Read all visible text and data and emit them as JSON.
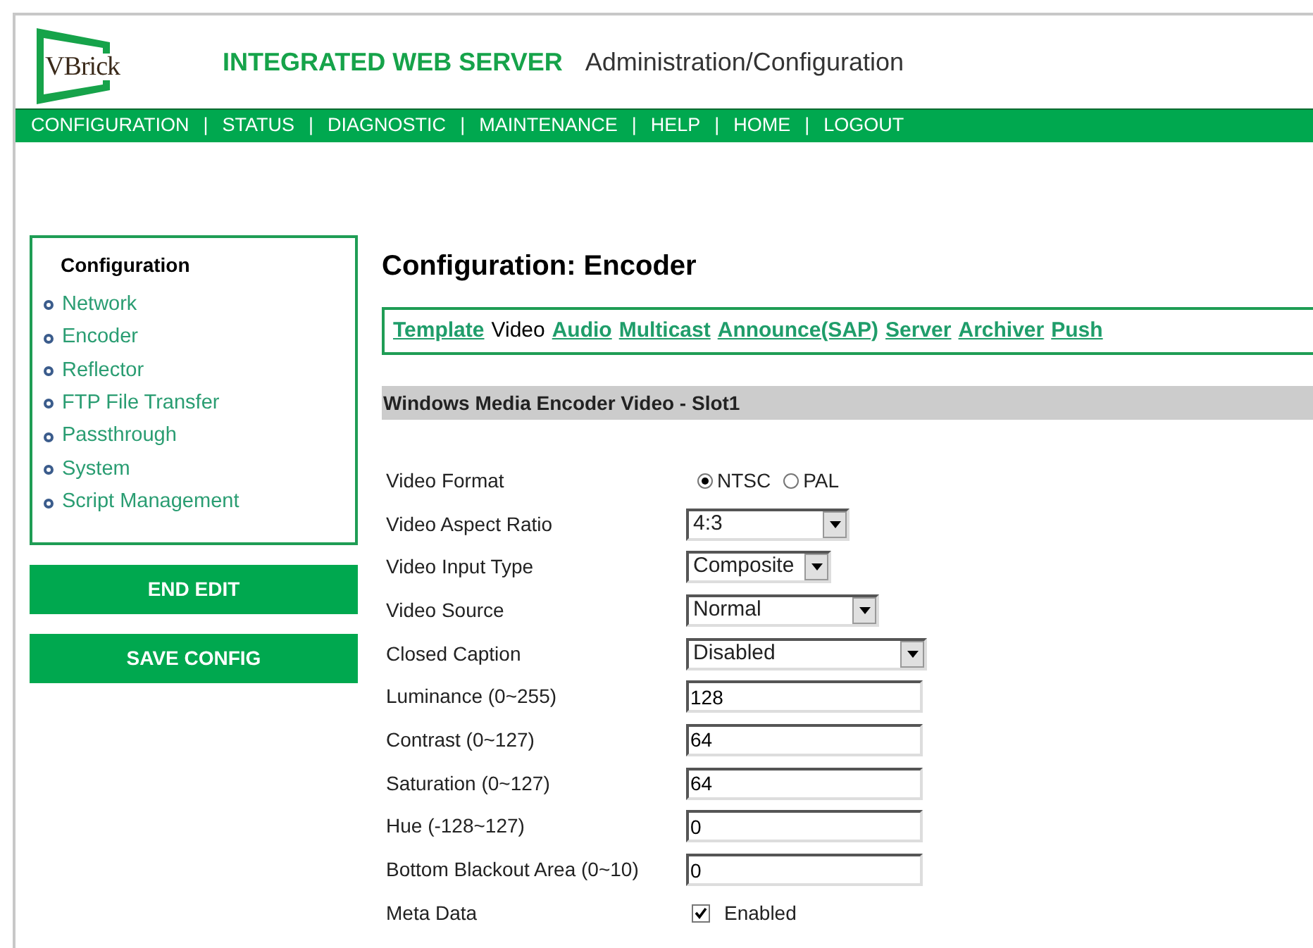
{
  "header": {
    "logo_text": "VBrick",
    "title": "INTEGRATED WEB SERVER",
    "subtitle": "Administration/Configuration"
  },
  "nav": [
    {
      "label": "CONFIGURATION",
      "separator": "|"
    },
    {
      "label": "STATUS",
      "separator": "|"
    },
    {
      "label": "DIAGNOSTIC",
      "separator": "|"
    },
    {
      "label": "MAINTENANCE",
      "separator": "|"
    },
    {
      "label": "HELP",
      "separator": "|"
    },
    {
      "label": "HOME",
      "separator": "|"
    },
    {
      "label": "LOGOUT"
    }
  ],
  "sidebar": {
    "title": "Configuration",
    "items": [
      "Network",
      "Encoder",
      "Reflector",
      "FTP File Transfer",
      "Passthrough",
      "System",
      "Script Management"
    ]
  },
  "buttons": [
    "END EDIT",
    "SAVE CONFIG"
  ],
  "page_title": "Configuration: Encoder",
  "tabs": [
    {
      "label": "Template",
      "selected": false
    },
    {
      "label": "Video",
      "selected": true
    },
    {
      "label": "Audio",
      "selected": false
    },
    {
      "label": "Multicast",
      "selected": false
    },
    {
      "label": "Announce(SAP)",
      "selected": false
    },
    {
      "label": "Server",
      "selected": false
    },
    {
      "label": "Archiver",
      "selected": false
    },
    {
      "label": "Push",
      "selected": false
    }
  ],
  "section_title": "Windows Media Encoder Video - Slot1",
  "fields": [
    {
      "kind": "radio",
      "label": "Video Format",
      "options": [
        {
          "label": "NTSC",
          "selected": true
        },
        {
          "label": "PAL",
          "selected": false
        }
      ]
    },
    {
      "kind": "select",
      "label": "Video Aspect Ratio",
      "value": "4:3"
    },
    {
      "kind": "select",
      "label": "Video Input Type",
      "value": "Composite"
    },
    {
      "kind": "select",
      "label": "Video Source",
      "value": "Normal"
    },
    {
      "kind": "select",
      "label": "Closed Caption",
      "value": "Disabled"
    },
    {
      "kind": "text",
      "label": "Luminance (0~255)",
      "value": "128"
    },
    {
      "kind": "text",
      "label": "Contrast (0~127)",
      "value": "64"
    },
    {
      "kind": "text",
      "label": "Saturation (0~127)",
      "value": "64"
    },
    {
      "kind": "text",
      "label": "Hue (-128~127)",
      "value": "0"
    },
    {
      "kind": "text",
      "label": "Bottom Blackout Area (0~10)",
      "value": "0"
    },
    {
      "kind": "checkbox",
      "label": "Meta Data",
      "option": "Enabled",
      "checked": true
    }
  ]
}
